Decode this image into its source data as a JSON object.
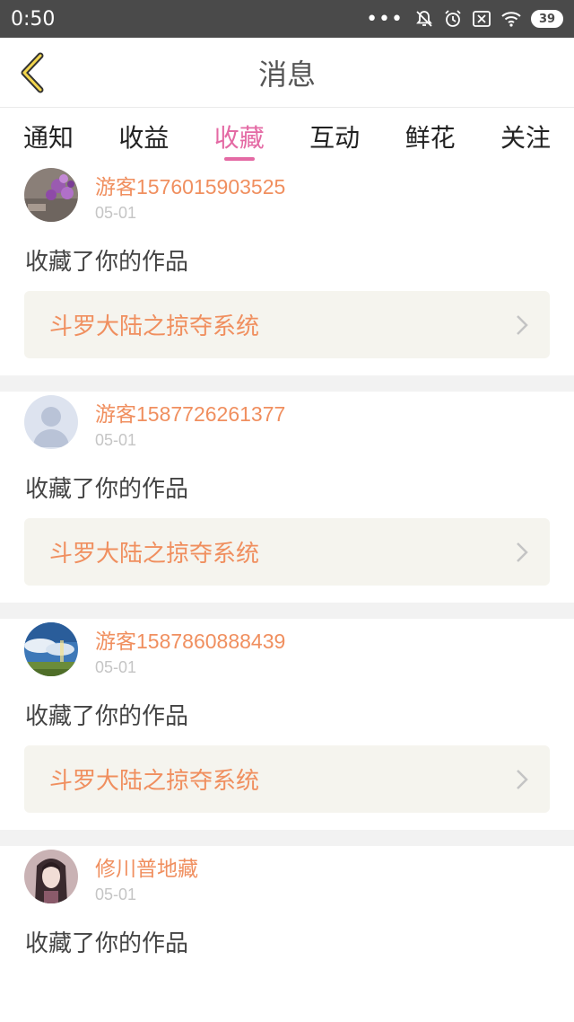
{
  "status_bar": {
    "time": "0:50",
    "dots": "•••",
    "battery": "39",
    "icons": [
      "bell-off-icon",
      "alarm-icon",
      "sim-off-icon",
      "wifi-icon",
      "battery-icon"
    ]
  },
  "header": {
    "title": "消息",
    "back_icon": "chevron-left-icon"
  },
  "tabs": [
    {
      "label": "通知",
      "active": false
    },
    {
      "label": "收益",
      "active": false
    },
    {
      "label": "收藏",
      "active": true
    },
    {
      "label": "互动",
      "active": false
    },
    {
      "label": "鲜花",
      "active": false
    },
    {
      "label": "关注",
      "active": false
    }
  ],
  "colors": {
    "accent": "#e46aa4",
    "username": "#f08f5f",
    "link_bg": "#f5f4ee"
  },
  "feed": [
    {
      "username": "游客1576015903525",
      "date": "05-01",
      "action": "收藏了你的作品",
      "work": "斗罗大陆之掠夺系统",
      "avatar": "flowers-avatar"
    },
    {
      "username": "游客1587726261377",
      "date": "05-01",
      "action": "收藏了你的作品",
      "work": "斗罗大陆之掠夺系统",
      "avatar": "default-avatar"
    },
    {
      "username": "游客1587860888439",
      "date": "05-01",
      "action": "收藏了你的作品",
      "work": "斗罗大陆之掠夺系统",
      "avatar": "landscape-avatar"
    },
    {
      "username": "修川普地藏",
      "date": "05-01",
      "action": "收藏了你的作品",
      "work": "",
      "avatar": "character-avatar"
    }
  ]
}
